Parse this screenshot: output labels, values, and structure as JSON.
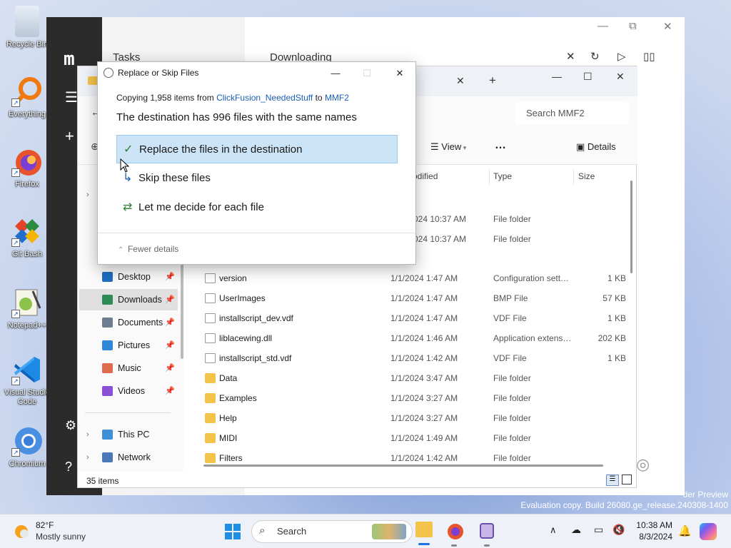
{
  "desktop": {
    "icons": [
      {
        "label": "Recycle Bin",
        "icon": "recycle-bin-icon"
      },
      {
        "label": "Everything",
        "icon": "everything-icon"
      },
      {
        "label": "Firefox",
        "icon": "firefox-icon"
      },
      {
        "label": "Git Bash",
        "icon": "git-bash-icon"
      },
      {
        "label": "Notepad++",
        "icon": "notepad-plus-plus-icon"
      },
      {
        "label": "Visual Studio Code",
        "icon": "vscode-icon"
      },
      {
        "label": "Chromium",
        "icon": "chromium-icon"
      }
    ]
  },
  "downloader": {
    "logo": "m",
    "tasks_label": "Tasks",
    "downloading_label": "Downloading"
  },
  "explorer": {
    "search_placeholder": "Search MMF2",
    "view_label": "View",
    "more_label": "…",
    "details_label": "Details",
    "columns": {
      "modified": "odified",
      "type": "Type",
      "size": "Size"
    },
    "nav": [
      {
        "label": "Desktop",
        "pinned": true,
        "selected": false,
        "icon": "desktop-icon",
        "color": "#1f6fbf"
      },
      {
        "label": "Downloads",
        "pinned": true,
        "selected": true,
        "icon": "download-icon",
        "color": "#2e8b57"
      },
      {
        "label": "Documents",
        "pinned": true,
        "selected": false,
        "icon": "documents-icon",
        "color": "#6e7c8f"
      },
      {
        "label": "Pictures",
        "pinned": true,
        "selected": false,
        "icon": "pictures-icon",
        "color": "#2f86d6"
      },
      {
        "label": "Music",
        "pinned": true,
        "selected": false,
        "icon": "music-icon",
        "color": "#e06a4c"
      },
      {
        "label": "Videos",
        "pinned": true,
        "selected": false,
        "icon": "videos-icon",
        "color": "#8b4fd6"
      }
    ],
    "nav_bottom": [
      {
        "label": "This PC",
        "icon": "this-pc-icon"
      },
      {
        "label": "Network",
        "icon": "network-icon"
      }
    ],
    "rows_partial": [
      {
        "date": "024 10:37 AM",
        "type": "File folder"
      },
      {
        "date": "024 10:37 AM",
        "type": "File folder"
      }
    ],
    "rows": [
      {
        "name": "version",
        "date": "1/1/2024 1:47 AM",
        "type": "Configuration sett…",
        "size": "1 KB",
        "kind": "config"
      },
      {
        "name": "UserImages",
        "date": "1/1/2024 1:47 AM",
        "type": "BMP File",
        "size": "57 KB",
        "kind": "image"
      },
      {
        "name": "installscript_dev.vdf",
        "date": "1/1/2024 1:47 AM",
        "type": "VDF File",
        "size": "1 KB",
        "kind": "file"
      },
      {
        "name": "liblacewing.dll",
        "date": "1/1/2024 1:46 AM",
        "type": "Application extens…",
        "size": "202 KB",
        "kind": "dll"
      },
      {
        "name": "installscript_std.vdf",
        "date": "1/1/2024 1:42 AM",
        "type": "VDF File",
        "size": "1 KB",
        "kind": "file"
      },
      {
        "name": "Data",
        "date": "1/1/2024 3:47 AM",
        "type": "File folder",
        "size": "",
        "kind": "folder"
      },
      {
        "name": "Examples",
        "date": "1/1/2024 3:27 AM",
        "type": "File folder",
        "size": "",
        "kind": "folder"
      },
      {
        "name": "Help",
        "date": "1/1/2024 3:27 AM",
        "type": "File folder",
        "size": "",
        "kind": "folder"
      },
      {
        "name": "MIDI",
        "date": "1/1/2024 1:49 AM",
        "type": "File folder",
        "size": "",
        "kind": "folder"
      },
      {
        "name": "Filters",
        "date": "1/1/2024 1:42 AM",
        "type": "File folder",
        "size": "",
        "kind": "folder"
      }
    ],
    "status_count": "35 items"
  },
  "dialog": {
    "title": "Replace or Skip Files",
    "copy_prefix": "Copying 1,958 items from ",
    "source": "ClickFusion_NeededStuff",
    "copy_to": " to ",
    "destination": "MMF2",
    "dest_message": "The destination has 996 files with the same names",
    "options": [
      {
        "label": "Replace the files in the destination",
        "icon": "checkmark-icon",
        "highlighted": true
      },
      {
        "label": "Skip these files",
        "icon": "skip-arrow-icon",
        "highlighted": false
      },
      {
        "label": "Let me decide for each file",
        "icon": "compare-files-icon",
        "highlighted": false
      }
    ],
    "fewer_details": "Fewer details"
  },
  "taskbar": {
    "weather_temp": "82°F",
    "weather_cond": "Mostly sunny",
    "search_label": "Search",
    "time": "10:38 AM",
    "date": "8/3/2024",
    "watermark_line1": "der Preview",
    "watermark_line2": "Evaluation copy. Build 26080.ge_release.240308-1400"
  }
}
